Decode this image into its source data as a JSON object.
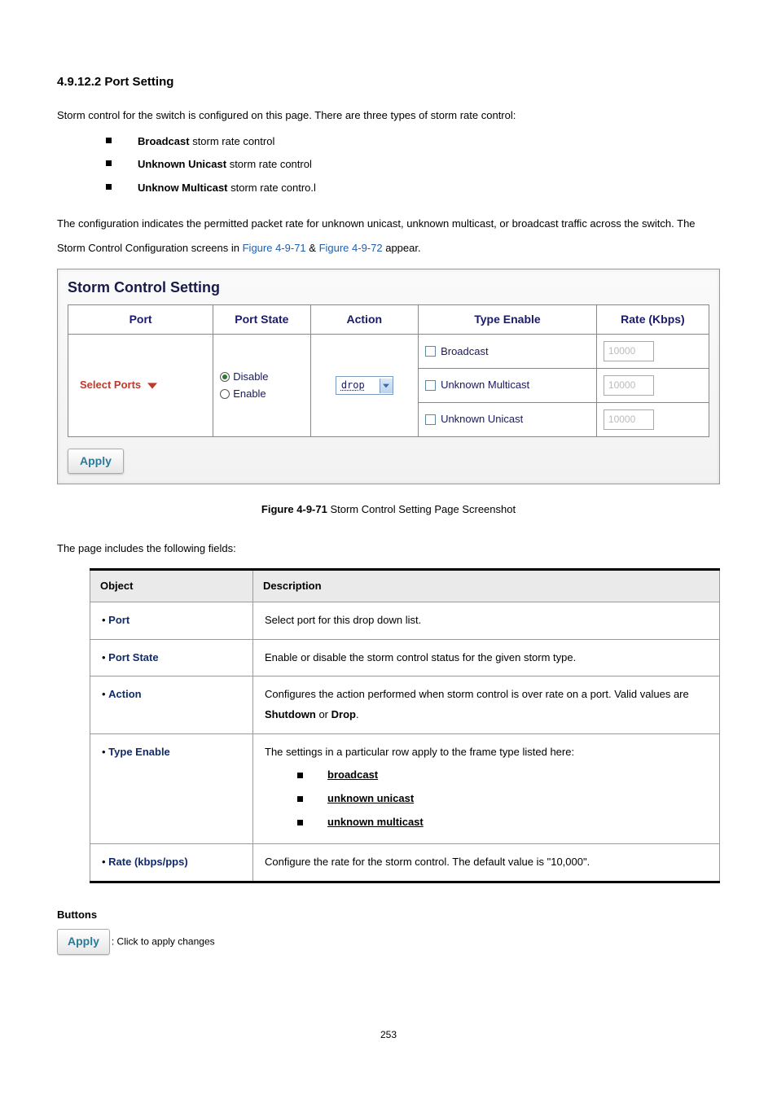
{
  "section": {
    "number": "4.9.12.2",
    "title": "Port Setting"
  },
  "intro": "Storm control for the switch is configured on this page. There are three types of storm rate control:",
  "storm_types": [
    {
      "bold": "Broadcast",
      "rest": " storm rate control"
    },
    {
      "bold": "Unknown Unicast",
      "rest": " storm rate control"
    },
    {
      "bold": "Unknow Multicast",
      "rest": " storm rate contro.l"
    }
  ],
  "config_text_pre": "The configuration indicates the permitted packet rate for unknown unicast, unknown multicast, or broadcast traffic across the switch. The Storm Control Configuration screens in ",
  "link1": "Figure 4-9-71",
  "amp": " & ",
  "link2": "Figure 4-9-72",
  "config_text_post": " appear.",
  "figure": {
    "title": "Storm Control Setting",
    "headers": {
      "port": "Port",
      "port_state": "Port State",
      "action": "Action",
      "type_enable": "Type Enable",
      "rate": "Rate (Kbps)"
    },
    "port_select": "Select Ports",
    "port_state_options": {
      "disable": "Disable",
      "enable": "Enable"
    },
    "action_value": "drop",
    "types": {
      "broadcast": "Broadcast",
      "unknown_multicast": "Unknown Multicast",
      "unknown_unicast": "Unknown Unicast"
    },
    "rate_values": {
      "r1": "10000",
      "r2": "10000",
      "r3": "10000"
    },
    "apply": "Apply"
  },
  "figure_caption_bold": "Figure 4-9-71",
  "figure_caption_rest": " Storm Control Setting Page Screenshot",
  "page_includes": "The page includes the following fields:",
  "desc_headers": {
    "object": "Object",
    "description": "Description"
  },
  "desc_rows": {
    "port": {
      "label": "Port",
      "text": "Select port for this drop down list."
    },
    "port_state": {
      "label": "Port State",
      "text": "Enable or disable the storm control status for the given storm type."
    },
    "action": {
      "label": "Action",
      "text_pre": "Configures the action performed when storm control is over rate on a port. Valid values are ",
      "b1": "Shutdown",
      "or": " or ",
      "b2": "Drop",
      "text_post": "."
    },
    "type_enable": {
      "label": "Type Enable",
      "text": "The settings in a particular row apply to the frame type listed here:",
      "items": [
        "broadcast",
        "unknown unicast",
        "unknown multicast"
      ]
    },
    "rate": {
      "label": "Rate (kbps/pps)",
      "text": "Configure the rate for the storm control. The default value is \"10,000\"."
    }
  },
  "buttons": {
    "title": "Buttons",
    "apply": "Apply",
    "apply_desc": ": Click to apply changes"
  },
  "page_number": "253"
}
